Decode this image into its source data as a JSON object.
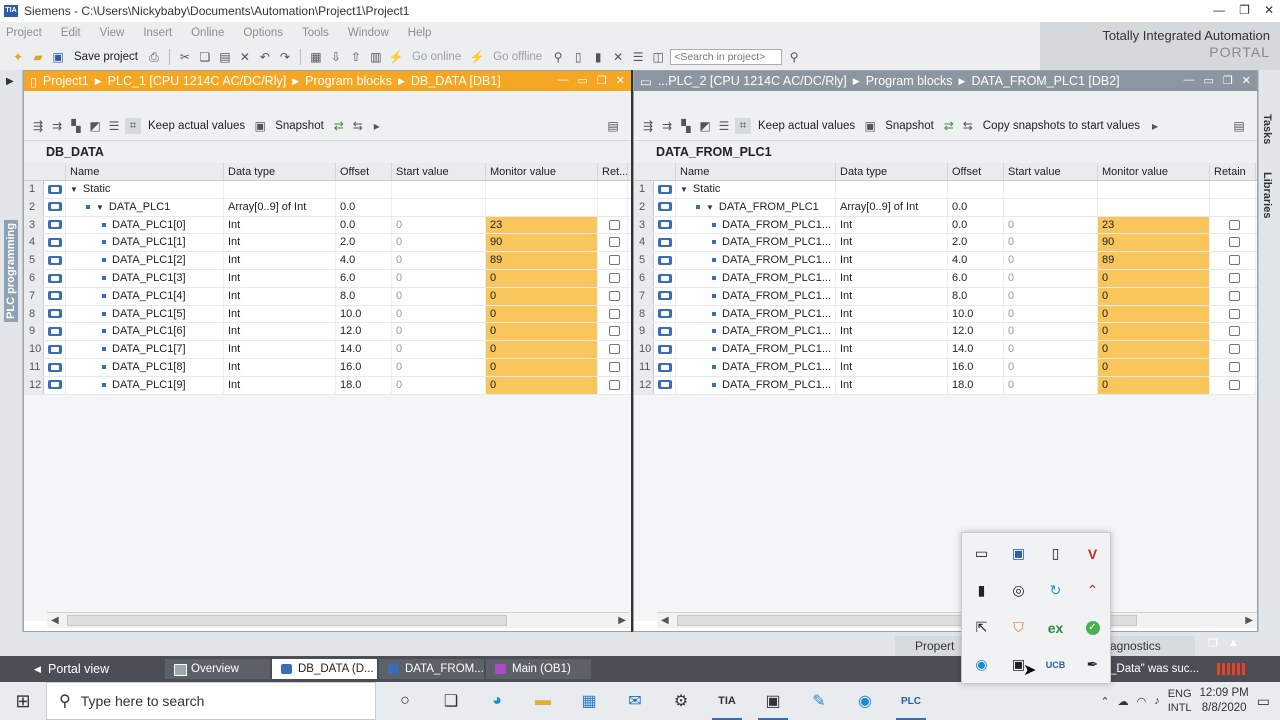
{
  "window": {
    "title": "Siemens  -  C:\\Users\\Nickybaby\\Documents\\Automation\\Project1\\Project1",
    "logo": "TIA"
  },
  "menu": [
    "Project",
    "Edit",
    "View",
    "Insert",
    "Online",
    "Options",
    "Tools",
    "Window",
    "Help"
  ],
  "toolbar": {
    "save": "Save project",
    "go_online": "Go online",
    "go_offline": "Go offline",
    "search_placeholder": "<Search in project>"
  },
  "brand": {
    "line1": "Totally Integrated Automation",
    "line2": "PORTAL"
  },
  "left_sidebar": {
    "label": "PLC programming"
  },
  "right_sidebar": {
    "tasks": "Tasks",
    "libraries": "Libraries"
  },
  "left_editor": {
    "breadcrumb": [
      "Project1",
      "PLC_1 [CPU 1214C AC/DC/Rly]",
      "Program blocks",
      "DB_DATA [DB1]"
    ],
    "tools": {
      "keep": "Keep actual values",
      "snapshot": "Snapshot"
    },
    "block_name": "DB_DATA",
    "headers": [
      "Name",
      "Data type",
      "Offset",
      "Start value",
      "Monitor value",
      "Ret..."
    ],
    "rows": [
      {
        "n": "1",
        "name": "Static",
        "type": "",
        "offset": "",
        "start": "",
        "monitor": "",
        "level": 0,
        "expand": true
      },
      {
        "n": "2",
        "name": "DATA_PLC1",
        "type": "Array[0..9] of Int",
        "offset": "0.0",
        "start": "",
        "monitor": "",
        "level": 1,
        "expand": true
      },
      {
        "n": "3",
        "name": "DATA_PLC1[0]",
        "type": "Int",
        "offset": "0.0",
        "start": "0",
        "monitor": "23",
        "level": 2
      },
      {
        "n": "4",
        "name": "DATA_PLC1[1]",
        "type": "Int",
        "offset": "2.0",
        "start": "0",
        "monitor": "90",
        "level": 2
      },
      {
        "n": "5",
        "name": "DATA_PLC1[2]",
        "type": "Int",
        "offset": "4.0",
        "start": "0",
        "monitor": "89",
        "level": 2
      },
      {
        "n": "6",
        "name": "DATA_PLC1[3]",
        "type": "Int",
        "offset": "6.0",
        "start": "0",
        "monitor": "0",
        "level": 2
      },
      {
        "n": "7",
        "name": "DATA_PLC1[4]",
        "type": "Int",
        "offset": "8.0",
        "start": "0",
        "monitor": "0",
        "level": 2
      },
      {
        "n": "8",
        "name": "DATA_PLC1[5]",
        "type": "Int",
        "offset": "10.0",
        "start": "0",
        "monitor": "0",
        "level": 2
      },
      {
        "n": "9",
        "name": "DATA_PLC1[6]",
        "type": "Int",
        "offset": "12.0",
        "start": "0",
        "monitor": "0",
        "level": 2
      },
      {
        "n": "10",
        "name": "DATA_PLC1[7]",
        "type": "Int",
        "offset": "14.0",
        "start": "0",
        "monitor": "0",
        "level": 2
      },
      {
        "n": "11",
        "name": "DATA_PLC1[8]",
        "type": "Int",
        "offset": "16.0",
        "start": "0",
        "monitor": "0",
        "level": 2
      },
      {
        "n": "12",
        "name": "DATA_PLC1[9]",
        "type": "Int",
        "offset": "18.0",
        "start": "0",
        "monitor": "0",
        "level": 2
      }
    ]
  },
  "right_editor": {
    "breadcrumb": [
      "...PLC_2 [CPU 1214C AC/DC/Rly]",
      "Program blocks",
      "DATA_FROM_PLC1 [DB2]"
    ],
    "tools": {
      "keep": "Keep actual values",
      "snapshot": "Snapshot",
      "copy": "Copy snapshots to start values"
    },
    "block_name": "DATA_FROM_PLC1",
    "headers": [
      "Name",
      "Data type",
      "Offset",
      "Start value",
      "Monitor value",
      "Retain"
    ],
    "rows": [
      {
        "n": "1",
        "name": "Static",
        "type": "",
        "offset": "",
        "start": "",
        "monitor": "",
        "level": 0,
        "expand": true
      },
      {
        "n": "2",
        "name": "DATA_FROM_PLC1",
        "type": "Array[0..9] of Int",
        "offset": "0.0",
        "start": "",
        "monitor": "",
        "level": 1,
        "expand": true
      },
      {
        "n": "3",
        "name": "DATA_FROM_PLC1...",
        "type": "Int",
        "offset": "0.0",
        "start": "0",
        "monitor": "23",
        "level": 2
      },
      {
        "n": "4",
        "name": "DATA_FROM_PLC1...",
        "type": "Int",
        "offset": "2.0",
        "start": "0",
        "monitor": "90",
        "level": 2
      },
      {
        "n": "5",
        "name": "DATA_FROM_PLC1...",
        "type": "Int",
        "offset": "4.0",
        "start": "0",
        "monitor": "89",
        "level": 2
      },
      {
        "n": "6",
        "name": "DATA_FROM_PLC1...",
        "type": "Int",
        "offset": "6.0",
        "start": "0",
        "monitor": "0",
        "level": 2
      },
      {
        "n": "7",
        "name": "DATA_FROM_PLC1...",
        "type": "Int",
        "offset": "8.0",
        "start": "0",
        "monitor": "0",
        "level": 2
      },
      {
        "n": "8",
        "name": "DATA_FROM_PLC1...",
        "type": "Int",
        "offset": "10.0",
        "start": "0",
        "monitor": "0",
        "level": 2
      },
      {
        "n": "9",
        "name": "DATA_FROM_PLC1...",
        "type": "Int",
        "offset": "12.0",
        "start": "0",
        "monitor": "0",
        "level": 2
      },
      {
        "n": "10",
        "name": "DATA_FROM_PLC1...",
        "type": "Int",
        "offset": "14.0",
        "start": "0",
        "monitor": "0",
        "level": 2
      },
      {
        "n": "11",
        "name": "DATA_FROM_PLC1...",
        "type": "Int",
        "offset": "16.0",
        "start": "0",
        "monitor": "0",
        "level": 2
      },
      {
        "n": "12",
        "name": "DATA_FROM_PLC1...",
        "type": "Int",
        "offset": "18.0",
        "start": "0",
        "monitor": "0",
        "level": 2
      }
    ]
  },
  "inspector": {
    "properties": "Propert",
    "diagnostics": "agnostics"
  },
  "portal": {
    "view": "Portal view",
    "tabs": [
      "Overview",
      "DB_DATA (D...",
      "DATA_FROM...",
      "Main (OB1)"
    ],
    "status": "_Data\" was suc..."
  },
  "taskbar": {
    "search": "Type here to search",
    "lang1": "ENG",
    "lang2": "INTL",
    "time": "12:09 PM",
    "date": "8/8/2020"
  },
  "colors": {
    "monitor": "#f8c65b",
    "active_title": "#f5a623",
    "inactive_title": "#8b96a0"
  }
}
